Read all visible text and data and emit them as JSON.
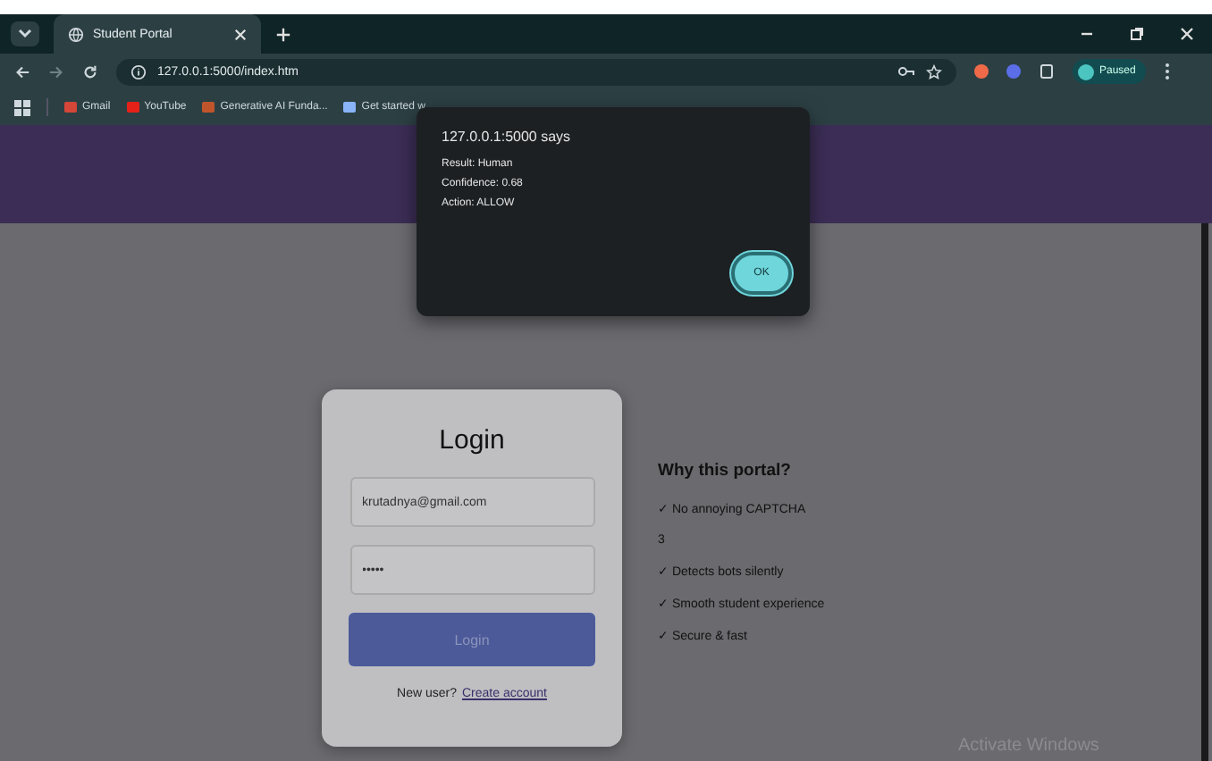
{
  "browser": {
    "tabs": [
      {
        "title": "Student Portal",
        "selected": true
      }
    ],
    "address": "127.0.0.1:5000/index.htm",
    "profile": "Paused",
    "bookmarks": [
      "Gmail",
      "YouTube",
      "Generative AI Funda...",
      "Get started w"
    ]
  },
  "dialog": {
    "title": "127.0.0.1:5000 says",
    "lines": [
      "Result: Human",
      "Confidence: 0.68",
      "Action: ALLOW"
    ],
    "button": "OK"
  },
  "login": {
    "title": "Login",
    "email": "krutadnya@gmail.com",
    "password": "•••••",
    "button": "Login",
    "prompt": "New user?",
    "link": "Create account"
  },
  "features": {
    "title": "Why this portal?",
    "items": [
      "✓ No annoying CAPTCHA",
      "3",
      "✓ Detects bots silently",
      "✓ Smooth student experience",
      "✓ Secure & fast"
    ]
  },
  "watermark": "Activate Windows"
}
